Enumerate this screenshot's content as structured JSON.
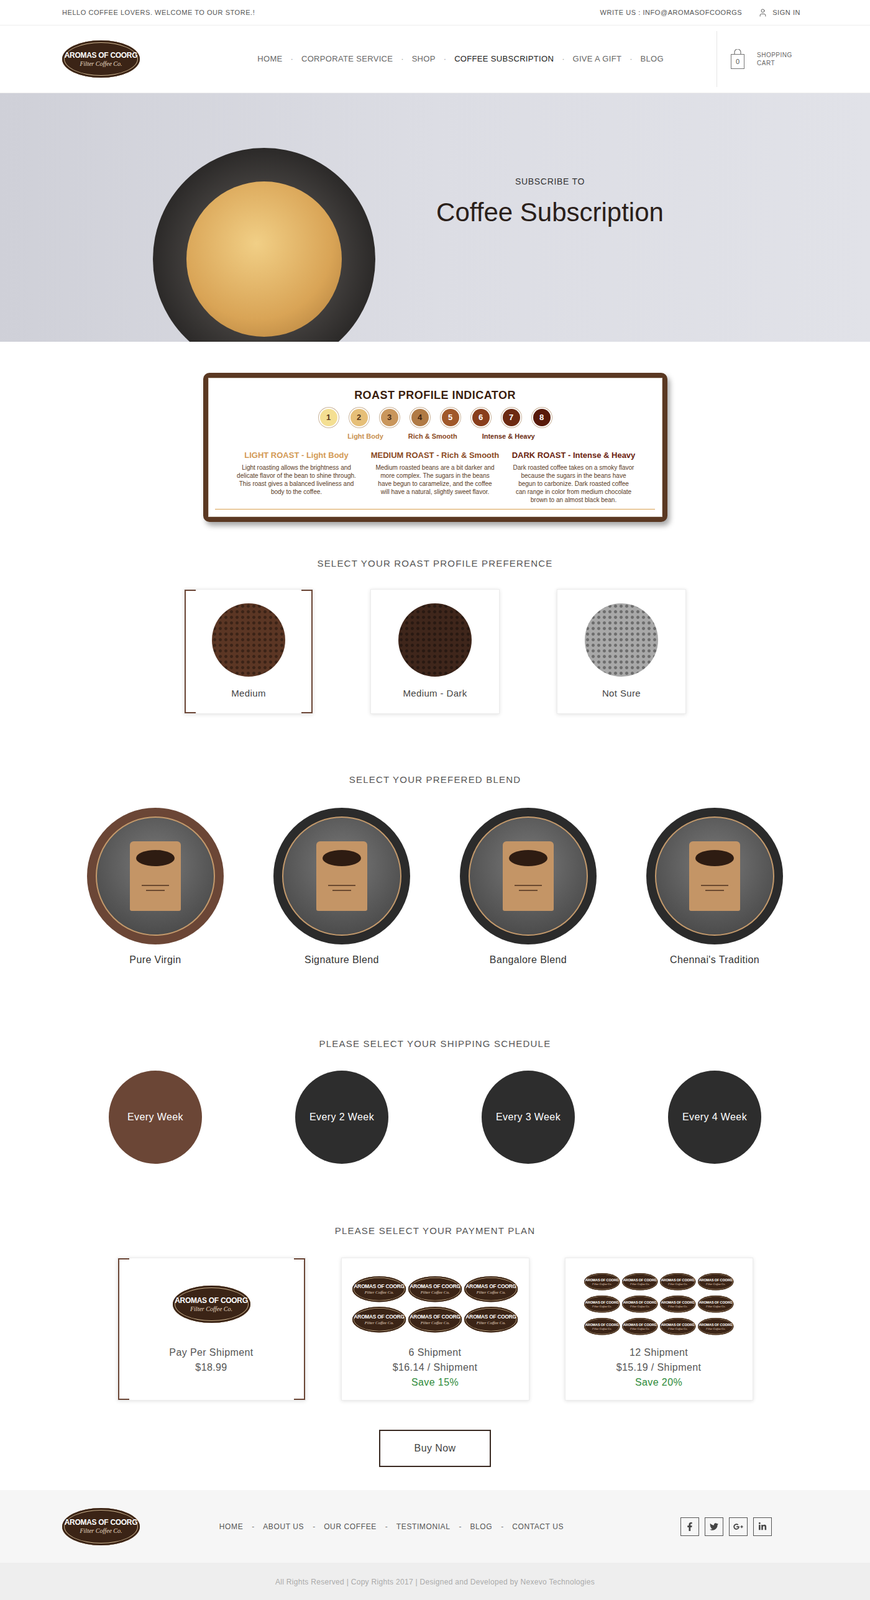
{
  "topbar": {
    "welcome": "HELLO COFFEE LOVERS. WELCOME TO OUR STORE.!",
    "contact": "WRITE US : INFO@AROMASOFCOORGS",
    "signin": "SIGN IN"
  },
  "logo": {
    "title": "AROMAS OF COORG",
    "subtitle": "Filter Coffee Co."
  },
  "nav": {
    "separator": "·",
    "items": [
      {
        "label": "HOME",
        "selected": false
      },
      {
        "label": "CORPORATE SERVICE",
        "selected": false
      },
      {
        "label": "SHOP",
        "selected": false
      },
      {
        "label": "COFFEE SUBSCRIPTION",
        "selected": true
      },
      {
        "label": "GIVE A GIFT",
        "selected": false
      },
      {
        "label": "BLOG",
        "selected": false
      }
    ]
  },
  "cart": {
    "count": "0",
    "label": [
      "SHOPPING",
      "CART"
    ]
  },
  "hero": {
    "kicker": "SUBSCRIBE TO",
    "title": "Coffee Subscription"
  },
  "roast_indicator": {
    "title": "ROAST PROFILE INDICATOR",
    "levels": [
      {
        "label": "1",
        "color": "#f4df92",
        "text_color": "#5a3a1a"
      },
      {
        "label": "2",
        "color": "#e6bf78",
        "text_color": "#5a3a1a"
      },
      {
        "label": "3",
        "color": "#c9965c",
        "text_color": "#4a2a12"
      },
      {
        "label": "4",
        "color": "#b07a45",
        "text_color": "#3a1f0c"
      },
      {
        "label": "5",
        "color": "#a0582a",
        "text_color": "#ffffff"
      },
      {
        "label": "6",
        "color": "#893e1c",
        "text_color": "#ffffff"
      },
      {
        "label": "7",
        "color": "#6d2a12",
        "text_color": "#ffffff"
      },
      {
        "label": "8",
        "color": "#581a0a",
        "text_color": "#ffffff"
      }
    ],
    "groups": [
      {
        "label": "Light Body",
        "color": "#c8904f"
      },
      {
        "label": "Rich & Smooth",
        "color": "#8b4a1f"
      },
      {
        "label": "Intense & Heavy",
        "color": "#6b2a10"
      }
    ],
    "columns": [
      {
        "title": "LIGHT ROAST - Light Body",
        "text": "Light roasting allows the brightness and delicate flavor of the bean to shine through. This roast gives a balanced liveliness and body to the coffee.",
        "color": "#d39a55"
      },
      {
        "title": "MEDIUM ROAST - Rich & Smooth",
        "text": "Medium roasted beans are a bit darker and more complex. The sugars in the beans have begun to caramelize, and the coffee will have a natural, slightly sweet flavor.",
        "color": "#8b4a1f"
      },
      {
        "title": "DARK ROAST -  Intense & Heavy",
        "text": "Dark roasted coffee takes on a smoky flavor because the sugars in the beans have begun to carbonize. Dark roasted coffee can range in color from medium chocolate brown to an almost black bean.",
        "color": "#6b2210"
      }
    ]
  },
  "roast": {
    "heading": "SELECT YOUR ROAST PROFILE PREFERENCE",
    "options": [
      {
        "label": "Medium",
        "selected": true,
        "color": "#5b3624"
      },
      {
        "label": "Medium - Dark",
        "selected": false,
        "color": "#3f261b"
      },
      {
        "label": "Not Sure",
        "selected": false,
        "color": "#a8a8a8"
      }
    ]
  },
  "blend": {
    "heading": "SELECT YOUR PREFERED BLEND",
    "options": [
      {
        "label": "Pure Virgin",
        "selected": true
      },
      {
        "label": "Signature Blend",
        "selected": false
      },
      {
        "label": "Bangalore Blend",
        "selected": false
      },
      {
        "label": "Chennai's Tradition",
        "selected": false
      }
    ]
  },
  "shipping": {
    "heading": "PLEASE SELECT YOUR SHIPPING SCHEDULE",
    "options": [
      {
        "label": "Every Week",
        "selected": true
      },
      {
        "label": "Every 2 Week",
        "selected": false
      },
      {
        "label": "Every 3 Week",
        "selected": false
      },
      {
        "label": "Every 4 Week",
        "selected": false
      }
    ]
  },
  "payment": {
    "heading": "PLEASE SELECT YOUR PAYMENT PLAN",
    "plans": [
      {
        "name": "Pay Per Shipment",
        "price": "$18.99",
        "logos": 1,
        "selected": true
      },
      {
        "name": "6 Shipment",
        "price": "$16.14 / Shipment",
        "save": "Save 15%",
        "logos": 6,
        "selected": false
      },
      {
        "name": "12 Shipment",
        "price": "$15.19 / Shipment",
        "save": "Save 20%",
        "logos": 12,
        "selected": false
      }
    ]
  },
  "buy_button": "Buy Now",
  "footer": {
    "separator": "-",
    "nav": [
      "HOME",
      "ABOUT US",
      "OUR COFFEE",
      "TESTIMONIAL",
      "BLOG",
      "CONTACT US"
    ],
    "copyright": "All Rights Reserved | Copy Rights 2017 | Designed and Developed by Nexevo Technologies"
  }
}
